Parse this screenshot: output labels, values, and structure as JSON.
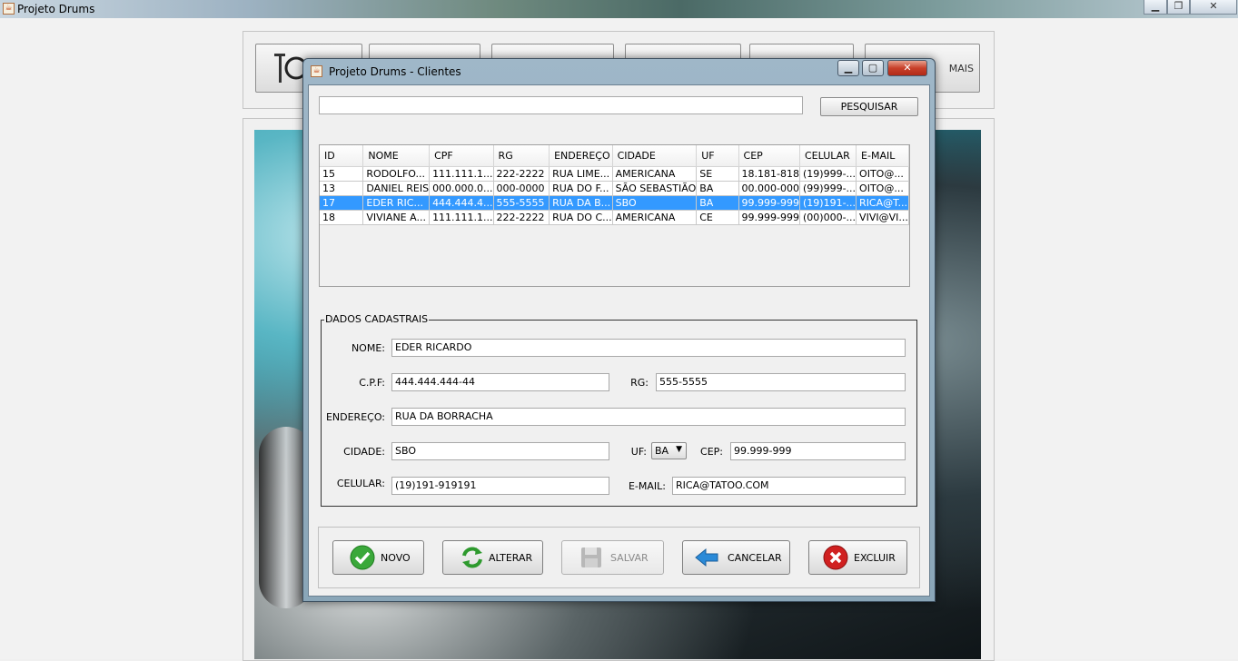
{
  "main_window": {
    "title": "Projeto Drums",
    "app_icon": "java-cup-icon"
  },
  "toolbar": {
    "more_label": "MAIS"
  },
  "dialog": {
    "title": "Projeto Drums - Clientes",
    "search": {
      "value": "",
      "button_label": "PESQUISAR"
    },
    "table": {
      "columns": [
        "ID",
        "NOME",
        "CPF",
        "RG",
        "ENDEREÇO",
        "CIDADE",
        "UF",
        "CEP",
        "CELULAR",
        "E-MAIL"
      ],
      "rows": [
        [
          "15",
          "RODOLFO...",
          "111.111.1...",
          "222-2222",
          "RUA LIME...",
          "AMERICANA",
          "SE",
          "18.181-818",
          "(19)999-...",
          "OITO@..."
        ],
        [
          "13",
          "DANIEL REIS",
          "000.000.0...",
          "000-0000",
          "RUA DO F...",
          "SÃO SEBASTIÃO",
          "BA",
          "00.000-000",
          "(99)999-...",
          "OITO@..."
        ],
        [
          "17",
          "EDER RIC...",
          "444.444.4...",
          "555-5555",
          "RUA DA B...",
          "SBO",
          "BA",
          "99.999-999",
          "(19)191-...",
          "RICA@T..."
        ],
        [
          "18",
          "VIVIANE A...",
          "111.111.1...",
          "222-2222",
          "RUA DO C...",
          "AMERICANA",
          "CE",
          "99.999-999",
          "(00)000-...",
          "VIVI@VI..."
        ]
      ],
      "selected_row": 2
    },
    "form": {
      "legend": "DADOS CADASTRAIS",
      "nome": {
        "label": "NOME:",
        "value": "EDER RICARDO"
      },
      "cpf": {
        "label": "C.P.F:",
        "value": "444.444.444-44"
      },
      "rg": {
        "label": "RG:",
        "value": "555-5555"
      },
      "endereco": {
        "label": "ENDEREÇO:",
        "value": "RUA DA BORRACHA"
      },
      "cidade": {
        "label": "CIDADE:",
        "value": "SBO"
      },
      "uf": {
        "label": "UF:",
        "value": "BA"
      },
      "cep": {
        "label": "CEP:",
        "value": "99.999-999"
      },
      "celular": {
        "label": "CELULAR:",
        "value": "(19)191-919191"
      },
      "email": {
        "label": "E-MAIL:",
        "value": "RICA@TATOO.COM"
      }
    },
    "actions": {
      "novo": "NOVO",
      "alterar": "ALTERAR",
      "salvar": "SALVAR",
      "cancelar": "CANCELAR",
      "excluir": "EXCLUIR"
    }
  },
  "colors": {
    "selection": "#3399ff",
    "novo_icon": "#3aa83a",
    "excluir_icon": "#d02020",
    "cancelar_icon": "#2a8ad8"
  }
}
